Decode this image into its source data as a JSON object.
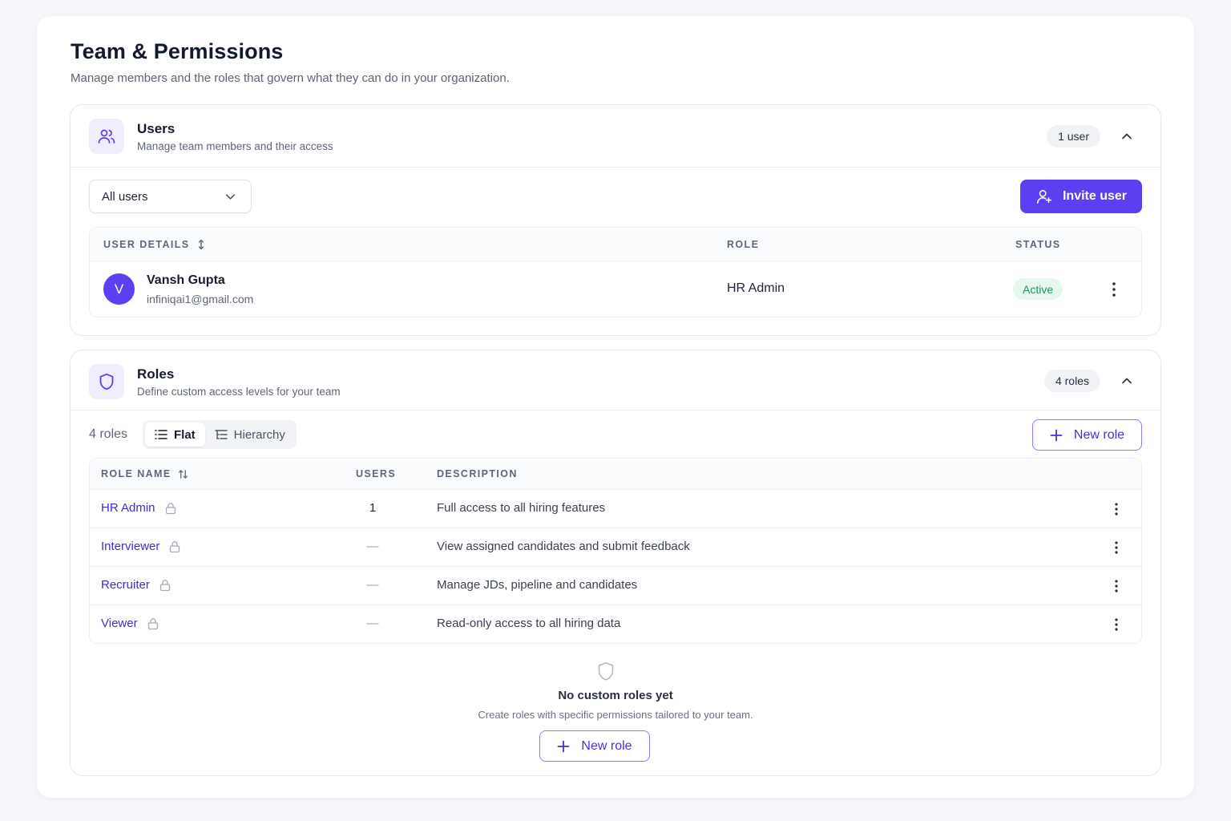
{
  "page": {
    "title": "Team & Permissions",
    "subtitle": "Manage members and the roles that govern what they can do in your organization."
  },
  "users_section": {
    "title": "Users",
    "description": "Manage team members and their access",
    "count_label": "1 user",
    "filter": {
      "selected": "All users"
    },
    "invite_label": "Invite user",
    "columns": {
      "details": "USER DETAILS",
      "role": "ROLE",
      "status": "STATUS"
    },
    "rows": [
      {
        "initial": "V",
        "name": "Vansh Gupta",
        "email": "infiniqai1@gmail.com",
        "role": "HR Admin",
        "status": "Active"
      }
    ]
  },
  "roles_section": {
    "title": "Roles",
    "description": "Define custom access levels for your team",
    "count_label": "4 roles",
    "toolbar_count": "4 roles",
    "view_toggle": {
      "flat": "Flat",
      "hierarchy": "Hierarchy"
    },
    "new_role_label": "New role",
    "columns": {
      "name": "ROLE NAME",
      "users": "USERS",
      "description": "DESCRIPTION"
    },
    "rows": [
      {
        "name": "HR Admin",
        "users": "1",
        "description": "Full access to all hiring features"
      },
      {
        "name": "Interviewer",
        "users": "—",
        "description": "View assigned candidates and submit feedback"
      },
      {
        "name": "Recruiter",
        "users": "—",
        "description": "Manage JDs, pipeline and candidates"
      },
      {
        "name": "Viewer",
        "users": "—",
        "description": "Read-only access to all hiring data"
      }
    ],
    "empty_state": {
      "title": "No custom roles yet",
      "description": "Create roles with specific permissions tailored to your team.",
      "button_label": "New role"
    }
  },
  "colors": {
    "accent": "#5b3ff0",
    "link": "#3b2fd0",
    "status_active_bg": "#e6f7ee",
    "status_active_text": "#1a9a5b"
  },
  "icons": {
    "users_section": "users-icon",
    "roles_section": "shield-icon",
    "collapse": "chevron-up-icon",
    "dropdown": "chevron-down-icon",
    "invite": "user-plus-icon",
    "sort": "sort-icon",
    "row_menu": "kebab-icon",
    "role_lock": "lock-icon",
    "flat_view": "list-icon",
    "hierarchy_view": "hierarchy-icon",
    "add": "plus-icon",
    "empty": "shield-outline-icon"
  }
}
